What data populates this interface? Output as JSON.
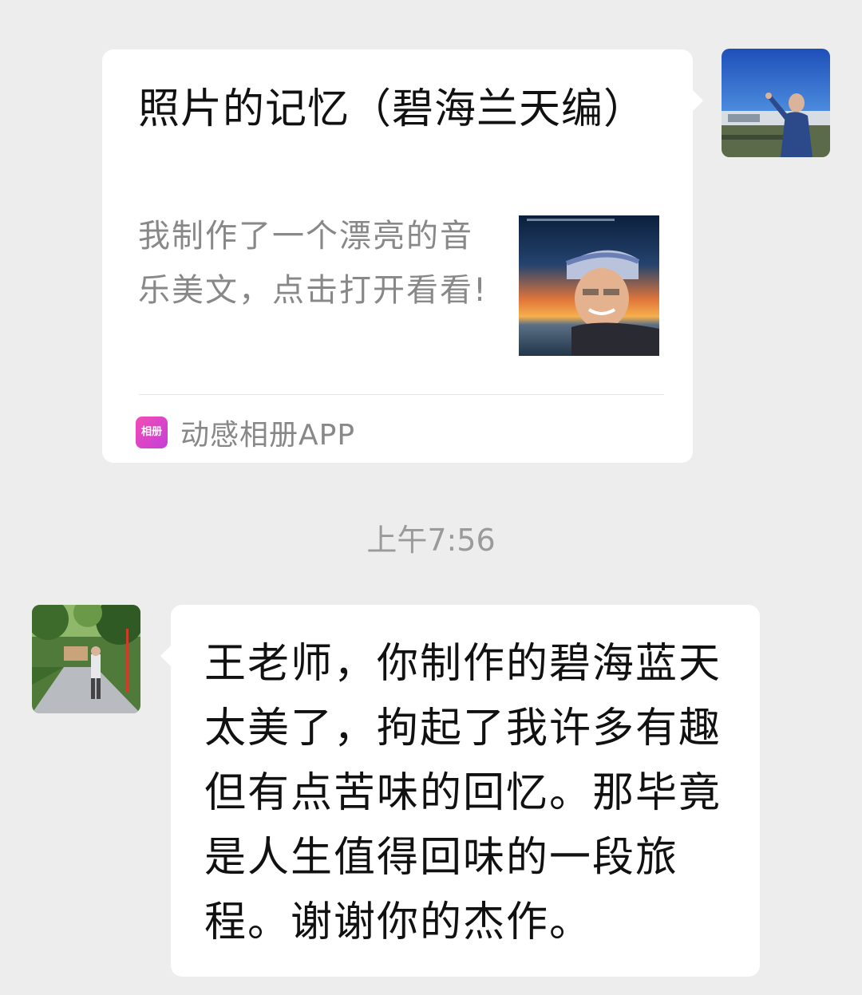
{
  "sent_message": {
    "card": {
      "title": "照片的记忆（碧海兰天编）",
      "description": "我制作了一个漂亮的音乐美文，点击打开看看!",
      "source_icon_text": "相册",
      "source_label": "动感相册APP"
    }
  },
  "timestamp": "上午7:56",
  "received_message": {
    "text": "王老师，你制作的碧海蓝天太美了，拘起了我许多有趣但有点苦味的回忆。那毕竟是人生值得回味的一段旅程。谢谢你的杰作。"
  },
  "colors": {
    "background": "#ededed",
    "bubble": "#ffffff",
    "secondary_text": "#888888",
    "app_icon": "#e548c4"
  },
  "icons": {
    "self_avatar": "avatar-photo-man-waving",
    "friend_avatar": "avatar-photo-man-on-road",
    "card_thumbnail": "thumbnail-photo-sunset-portrait",
    "app_icon": "album-app-icon"
  }
}
